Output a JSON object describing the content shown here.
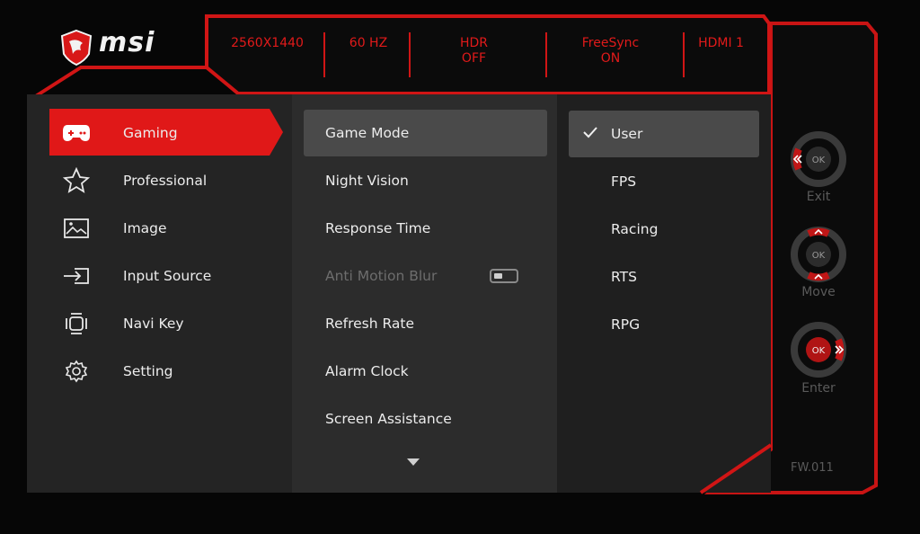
{
  "brand": {
    "name": "msi",
    "logo_icon": "msi-dragon-shield-icon"
  },
  "status_bar": [
    {
      "text": "2560X1440"
    },
    {
      "text": "60 HZ"
    },
    {
      "text": "HDR\nOFF"
    },
    {
      "text": "FreeSync\nON"
    },
    {
      "text": "HDMI 1"
    }
  ],
  "sidebar": {
    "items": [
      {
        "label": "Gaming",
        "icon": "gamepad-icon",
        "selected": true
      },
      {
        "label": "Professional",
        "icon": "star-icon"
      },
      {
        "label": "Image",
        "icon": "image-icon"
      },
      {
        "label": "Input Source",
        "icon": "input-source-icon"
      },
      {
        "label": "Navi Key",
        "icon": "navi-key-icon"
      },
      {
        "label": "Setting",
        "icon": "gear-icon"
      }
    ]
  },
  "submenu": {
    "items": [
      {
        "label": "Game Mode",
        "selected": true
      },
      {
        "label": "Night Vision"
      },
      {
        "label": "Response Time"
      },
      {
        "label": "Anti Motion Blur",
        "disabled": true,
        "toggle": "off"
      },
      {
        "label": "Refresh Rate"
      },
      {
        "label": "Alarm Clock"
      },
      {
        "label": "Screen Assistance"
      }
    ],
    "more_icon": "chevron-down-icon"
  },
  "options": {
    "items": [
      {
        "label": "User",
        "checked": true
      },
      {
        "label": "FPS"
      },
      {
        "label": "Racing"
      },
      {
        "label": "RTS"
      },
      {
        "label": "RPG"
      }
    ]
  },
  "nav_keys": [
    {
      "center": "OK",
      "label": "Exit",
      "active_direction": "left"
    },
    {
      "center": "OK",
      "label": "Move",
      "active_direction": "up-down"
    },
    {
      "center": "OK",
      "label": "Enter",
      "active_direction": "right"
    }
  ],
  "firmware": "FW.011",
  "colors": {
    "accent": "#e11a1a",
    "panel": "#2b2b2b",
    "panel_dark": "#1f1f1f",
    "selected": "#4a4a4a"
  }
}
